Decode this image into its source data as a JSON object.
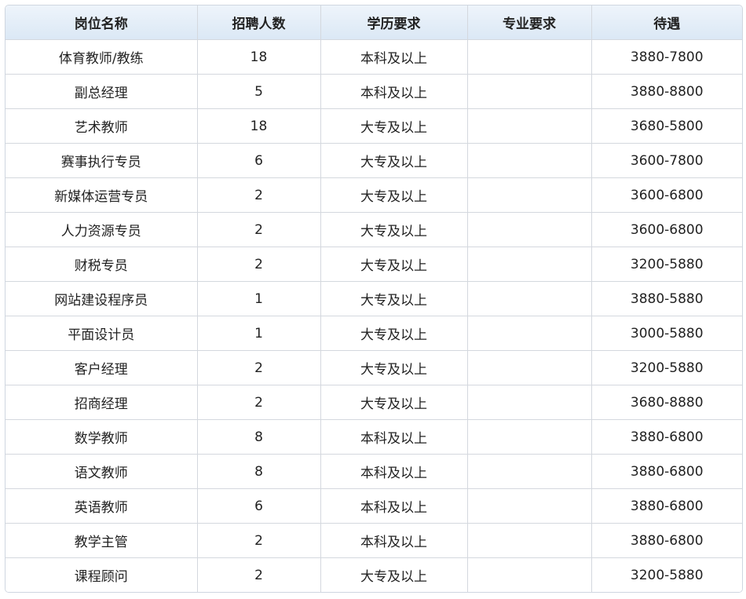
{
  "table": {
    "headers": [
      "岗位名称",
      "招聘人数",
      "学历要求",
      "专业要求",
      "待遇"
    ],
    "rows": [
      [
        "体育教师/教练",
        "18",
        "本科及以上",
        "",
        "3880-7800"
      ],
      [
        "副总经理",
        "5",
        "本科及以上",
        "",
        "3880-8800"
      ],
      [
        "艺术教师",
        "18",
        "大专及以上",
        "",
        "3680-5800"
      ],
      [
        "赛事执行专员",
        "6",
        "大专及以上",
        "",
        "3600-7800"
      ],
      [
        "新媒体运营专员",
        "2",
        "大专及以上",
        "",
        "3600-6800"
      ],
      [
        "人力资源专员",
        "2",
        "大专及以上",
        "",
        "3600-6800"
      ],
      [
        "财税专员",
        "2",
        "大专及以上",
        "",
        "3200-5880"
      ],
      [
        "网站建设程序员",
        "1",
        "大专及以上",
        "",
        "3880-5880"
      ],
      [
        "平面设计员",
        "1",
        "大专及以上",
        "",
        "3000-5880"
      ],
      [
        "客户经理",
        "2",
        "大专及以上",
        "",
        "3200-5880"
      ],
      [
        "招商经理",
        "2",
        "大专及以上",
        "",
        "3680-8880"
      ],
      [
        "数学教师",
        "8",
        "本科及以上",
        "",
        "3880-6800"
      ],
      [
        "语文教师",
        "8",
        "本科及以上",
        "",
        "3880-6800"
      ],
      [
        "英语教师",
        "6",
        "本科及以上",
        "",
        "3880-6800"
      ],
      [
        "教学主管",
        "2",
        "本科及以上",
        "",
        "3880-6800"
      ],
      [
        "课程顾问",
        "2",
        "大专及以上",
        "",
        "3200-5880"
      ]
    ]
  }
}
